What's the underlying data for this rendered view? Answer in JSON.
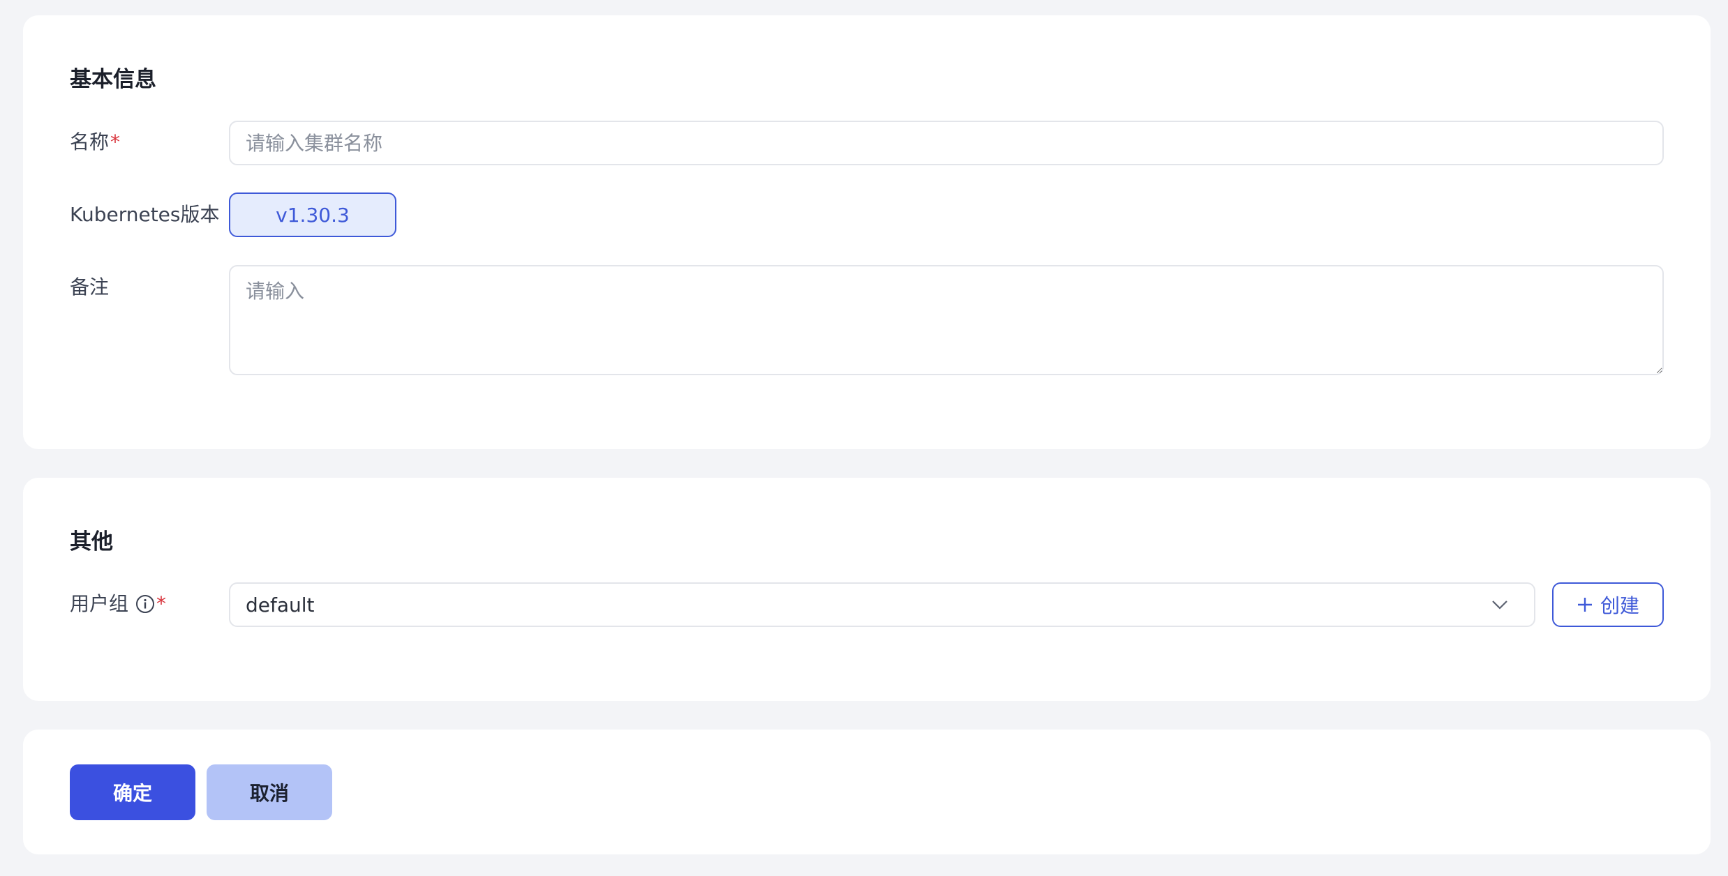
{
  "basic": {
    "title": "基本信息",
    "name_label": "名称",
    "name_required": "*",
    "name_placeholder": "请输入集群名称",
    "version_label": "Kubernetes版本",
    "version_value": "v1.30.3",
    "remark_label": "备注",
    "remark_placeholder": "请输入"
  },
  "other": {
    "title": "其他",
    "group_label": "用户组",
    "group_required": "*",
    "group_value": "default",
    "create_label": "创建"
  },
  "actions": {
    "confirm_label": "确定",
    "cancel_label": "取消"
  },
  "colors": {
    "accent": "#3e59d8",
    "primary_button": "#3b50e0",
    "secondary_button": "#b3c3f7",
    "required": "#d9363e",
    "background": "#f3f4f7"
  },
  "icons": [
    "info-icon",
    "chevron-down-icon",
    "plus-icon"
  ]
}
